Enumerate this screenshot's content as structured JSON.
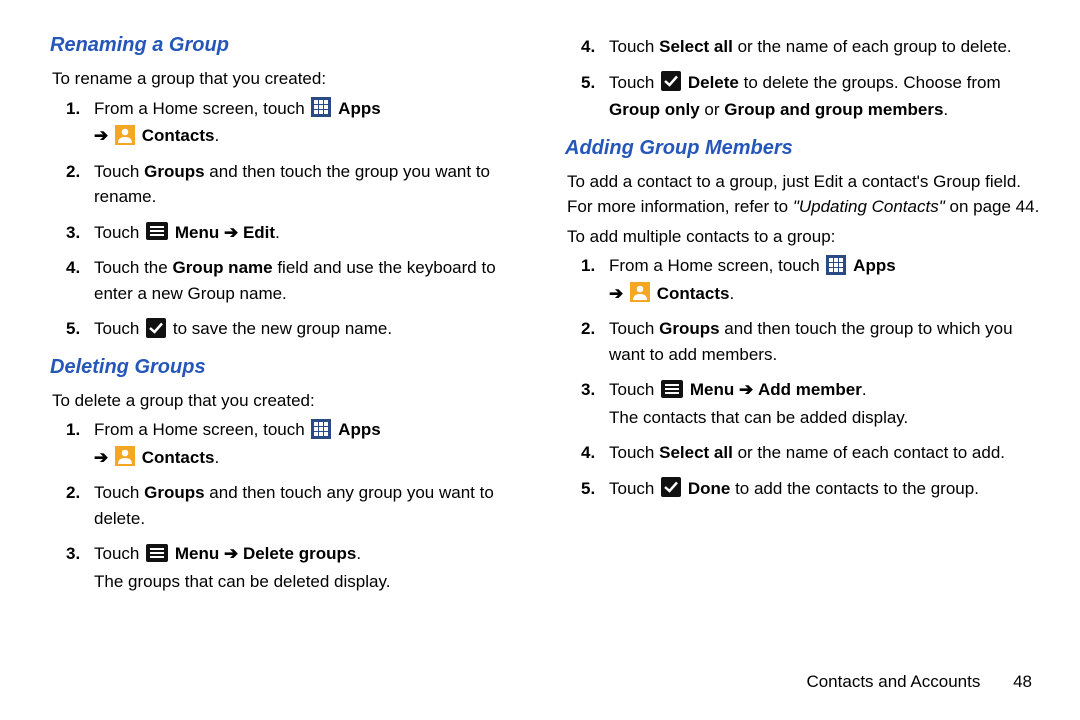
{
  "footer": {
    "section": "Contacts and Accounts",
    "page": "48"
  },
  "labels": {
    "apps": "Apps",
    "contacts": "Contacts",
    "menu": "Menu",
    "arrow": "➔",
    "edit": "Edit",
    "delete_groups": "Delete groups",
    "add_member": "Add member",
    "done": "Done",
    "delete_word": "Delete",
    "select_all": "Select all",
    "groups_word": "Groups",
    "group_name": "Group name",
    "group_only": "Group only",
    "group_and_members": "Group and group members",
    "touch": "Touch",
    "from_home": "From a Home screen, touch",
    "or": "or",
    "ref_contacts": "\"Updating Contacts\""
  },
  "renaming": {
    "heading": "Renaming a Group",
    "intro": "To rename a group that you created:",
    "step2": "and then touch the group you want to rename.",
    "step4_a": "Touch the",
    "step4_b": "field and use the keyboard to enter a new Group name.",
    "step5_a": "Touch",
    "step5_b": "to save the new group name."
  },
  "deleting": {
    "heading": "Deleting Groups",
    "intro": "To delete a group that you created:",
    "step2": "and then touch any group you want to delete.",
    "step3_sub": "The groups that can be deleted display.",
    "step4_a": "or the name of each group to delete.",
    "step5_a": "to delete the groups. Choose from"
  },
  "adding": {
    "heading": "Adding Group Members",
    "intro1": "To add a contact to a group, just Edit a contact's Group field. For more information, refer to",
    "intro1_ref": "on page 44.",
    "intro2": "To add multiple contacts to a group:",
    "step2": "and then touch the group to which you want to add members.",
    "step3_sub": "The contacts that can be added display.",
    "step4": "or the name of each contact to add.",
    "step5": "to add the contacts to the group."
  }
}
